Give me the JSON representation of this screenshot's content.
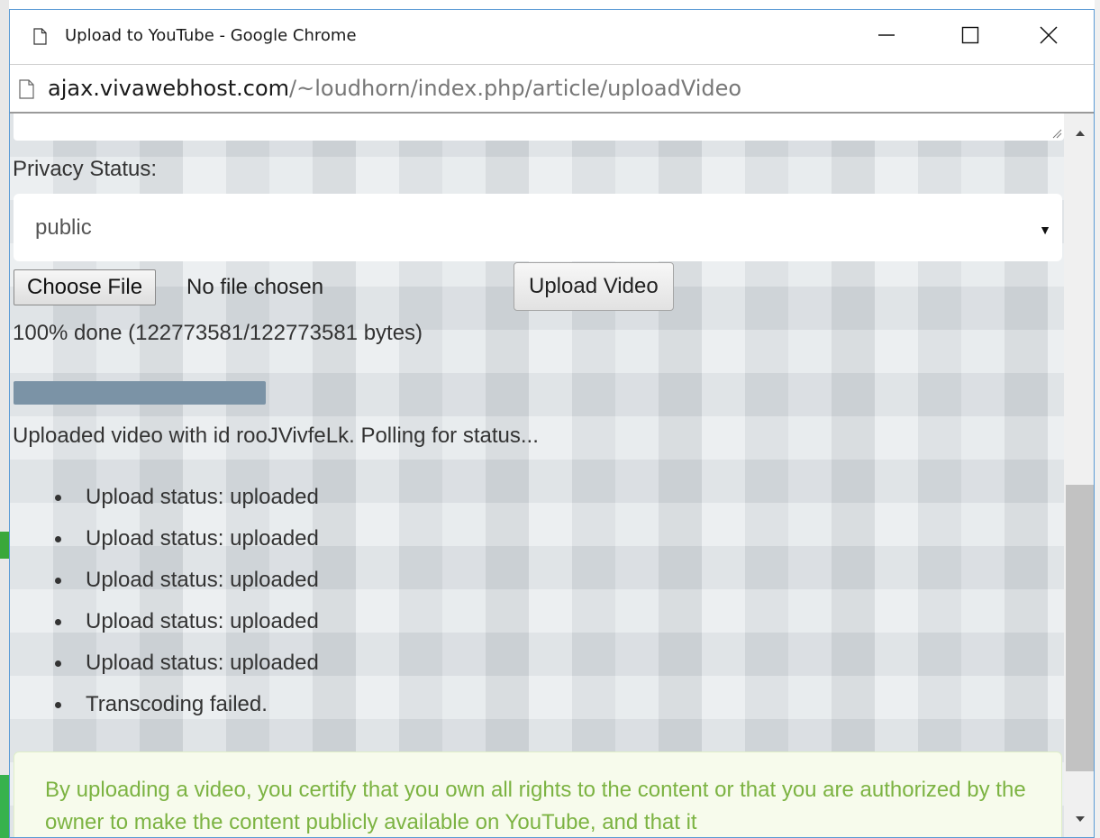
{
  "window": {
    "title": "Upload to YouTube - Google Chrome"
  },
  "address_bar": {
    "host": "ajax.vivawebhost.com",
    "path": "/~loudhorn/index.php/article/uploadVideo"
  },
  "form": {
    "privacy_label": "Privacy Status:",
    "privacy_value": "public",
    "choose_file_label": "Choose File",
    "no_file_text": "No file chosen",
    "upload_button_label": "Upload Video"
  },
  "progress": {
    "text": "100% done (122773581/122773581 bytes)",
    "fraction": 1.0,
    "fill_color": "#7b93a6"
  },
  "uploaded_message": "Uploaded video with id rooJVivfeLk. Polling for status...",
  "status_items": [
    "Upload status: uploaded",
    "Upload status: uploaded",
    "Upload status: uploaded",
    "Upload status: uploaded",
    "Upload status: uploaded",
    "Transcoding failed."
  ],
  "notice": {
    "text": "By uploading a video, you certify that you own all rights to the content or that you are authorized by the owner to make the content publicly available on YouTube, and that it",
    "color": "#7cb342"
  },
  "icons": {
    "page": "page-icon",
    "minimize": "minimize-icon",
    "maximize": "maximize-icon",
    "close": "close-icon",
    "dropdown": "dropdown-arrow-icon",
    "scroll_up": "scroll-up-icon",
    "scroll_down": "scroll-down-icon"
  },
  "colors": {
    "window_border": "#5b9bd5",
    "content_bg": "#dfe4e8"
  }
}
